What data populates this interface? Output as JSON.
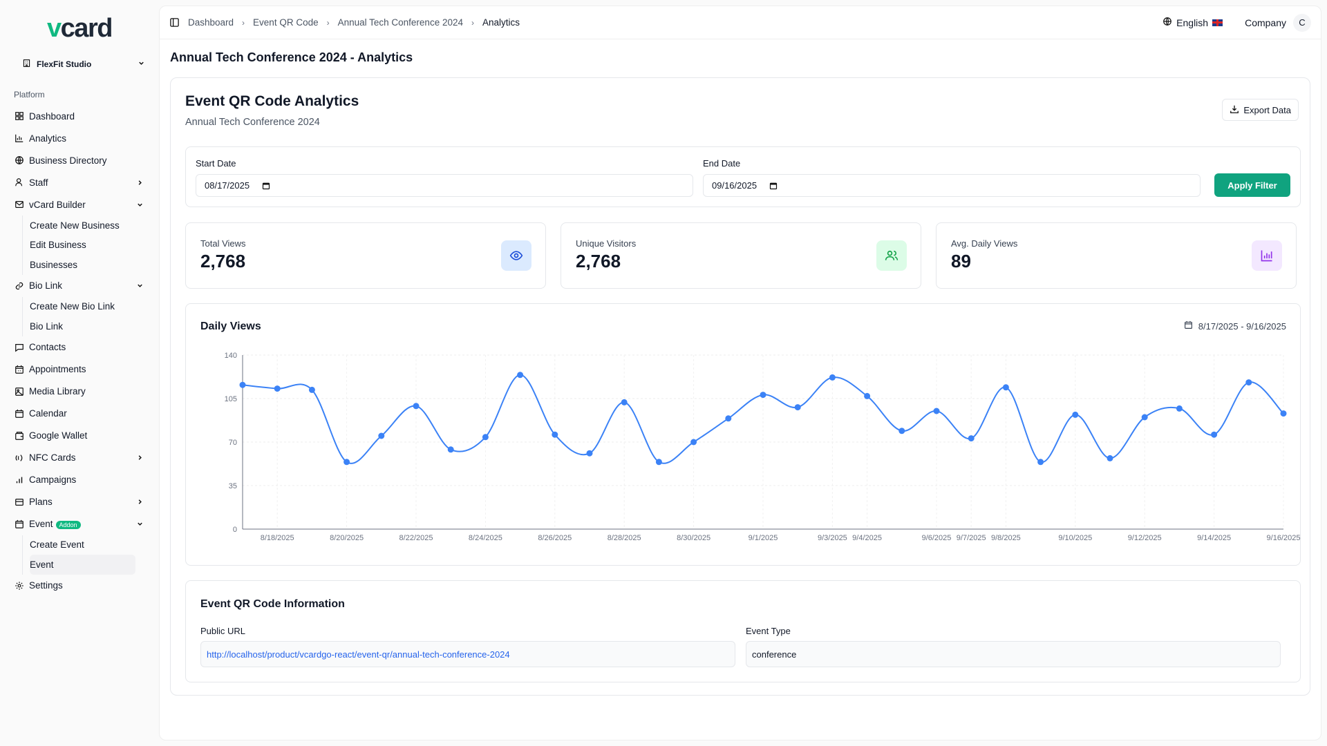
{
  "app": {
    "logo": "vcard",
    "business_name": "FlexFit Studio"
  },
  "sidebar": {
    "section_label": "Platform",
    "items": [
      {
        "label": "Dashboard"
      },
      {
        "label": "Analytics"
      },
      {
        "label": "Business Directory"
      },
      {
        "label": "Staff"
      },
      {
        "label": "vCard Builder"
      },
      {
        "label": "Create New Business"
      },
      {
        "label": "Edit Business"
      },
      {
        "label": "Businesses"
      },
      {
        "label": "Bio Link"
      },
      {
        "label": "Create New Bio Link"
      },
      {
        "label": "Bio Link"
      },
      {
        "label": "Contacts"
      },
      {
        "label": "Appointments"
      },
      {
        "label": "Media Library"
      },
      {
        "label": "Calendar"
      },
      {
        "label": "Google Wallet"
      },
      {
        "label": "NFC Cards"
      },
      {
        "label": "Campaigns"
      },
      {
        "label": "Plans"
      },
      {
        "label": "Event",
        "badge": "Addon"
      },
      {
        "label": "Create Event"
      },
      {
        "label": "Event"
      },
      {
        "label": "Settings"
      }
    ]
  },
  "header": {
    "breadcrumbs": [
      "Dashboard",
      "Event QR Code",
      "Annual Tech Conference 2024",
      "Analytics"
    ],
    "language": "English",
    "company": "Company",
    "avatar_initial": "C"
  },
  "page": {
    "title": "Annual Tech Conference 2024 - Analytics",
    "analytics_title": "Event QR Code Analytics",
    "analytics_subtitle": "Annual Tech Conference 2024",
    "export_label": "Export Data"
  },
  "filter": {
    "start_label": "Start Date",
    "start_value": "08/17/2025",
    "end_label": "End Date",
    "end_value": "09/16/2025",
    "apply_label": "Apply Filter"
  },
  "stats": [
    {
      "label": "Total Views",
      "value": "2,768",
      "color": "#3b82f6",
      "bg": "#dbeafe"
    },
    {
      "label": "Unique Visitors",
      "value": "2,768",
      "color": "#16a34a",
      "bg": "#dcfce7"
    },
    {
      "label": "Avg. Daily Views",
      "value": "89",
      "color": "#9333ea",
      "bg": "#f3e8ff"
    }
  ],
  "chart": {
    "title": "Daily Views",
    "range": "8/17/2025 - 9/16/2025"
  },
  "chart_data": {
    "type": "line",
    "title": "Daily Views",
    "x": [
      "8/17/2025",
      "8/18/2025",
      "8/19/2025",
      "8/20/2025",
      "8/21/2025",
      "8/22/2025",
      "8/23/2025",
      "8/24/2025",
      "8/25/2025",
      "8/26/2025",
      "8/27/2025",
      "8/28/2025",
      "8/29/2025",
      "8/30/2025",
      "8/31/2025",
      "9/1/2025",
      "9/2/2025",
      "9/3/2025",
      "9/4/2025",
      "9/5/2025",
      "9/6/2025",
      "9/7/2025",
      "9/8/2025",
      "9/9/2025",
      "9/10/2025",
      "9/11/2025",
      "9/12/2025",
      "9/13/2025",
      "9/14/2025",
      "9/15/2025",
      "9/16/2025"
    ],
    "tick_labels": [
      "8/18/2025",
      "8/20/2025",
      "8/22/2025",
      "8/24/2025",
      "8/26/2025",
      "8/28/2025",
      "8/30/2025",
      "9/1/2025",
      "9/3/2025",
      "9/4/2025",
      "9/6/2025",
      "9/7/2025",
      "9/8/2025",
      "9/10/2025",
      "9/12/2025",
      "9/14/2025",
      "9/16/2025"
    ],
    "series": [
      {
        "values": [
          116,
          113,
          112,
          54,
          75,
          99,
          64,
          74,
          124,
          76,
          61,
          102,
          54,
          70,
          89,
          108,
          98,
          122,
          107,
          79,
          95,
          73,
          114,
          54,
          92,
          57,
          90,
          97,
          76,
          118,
          93
        ],
        "color": "#3b82f6"
      }
    ],
    "ylim": [
      0,
      140
    ],
    "yticks": [
      0,
      35,
      70,
      105,
      140
    ],
    "grid": true
  },
  "info": {
    "title": "Event QR Code Information",
    "url_label": "Public URL",
    "url_value": "http://localhost/product/vcardgo-react/event-qr/annual-tech-conference-2024",
    "type_label": "Event Type",
    "type_value": "conference"
  }
}
